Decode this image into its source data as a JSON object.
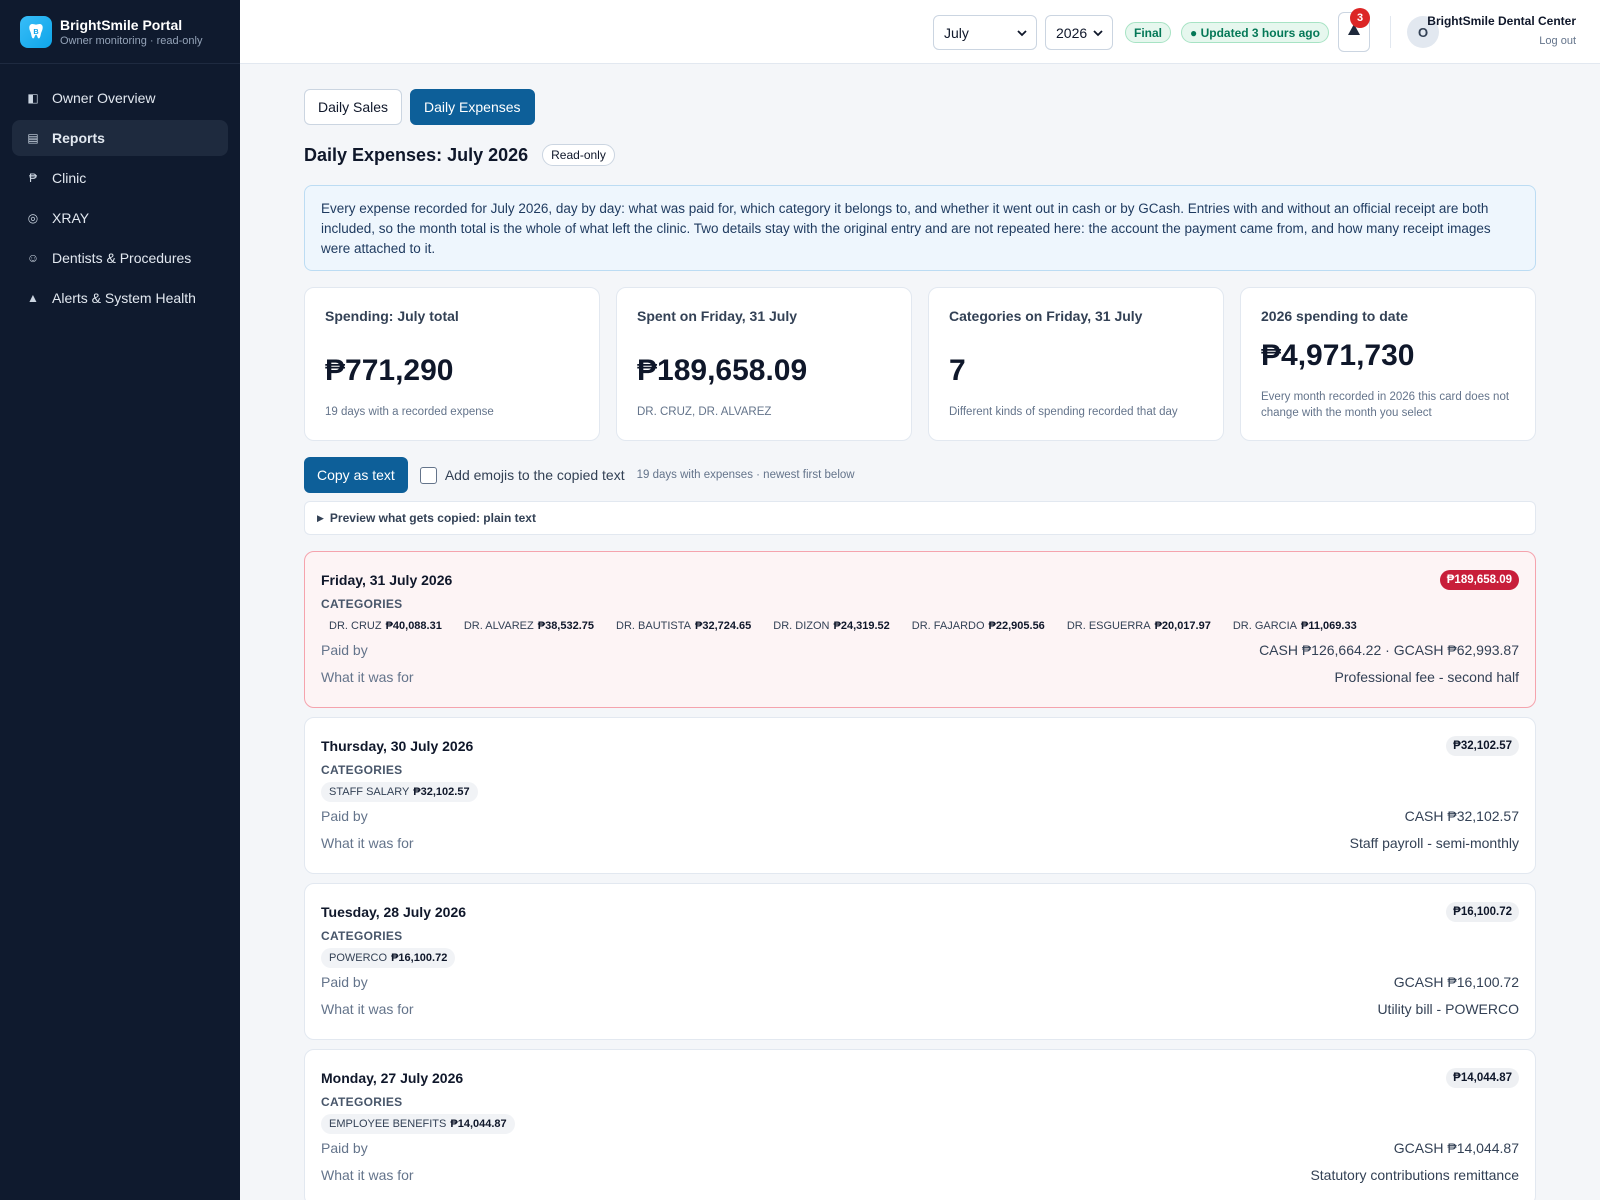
{
  "brand": {
    "name": "BrightSmile Portal",
    "subtitle": "Owner monitoring · read-only"
  },
  "sidebar": {
    "items": [
      {
        "label": "Owner Overview",
        "icon": "overview-icon",
        "glyph": "◧",
        "active": false
      },
      {
        "label": "Reports",
        "icon": "reports-icon",
        "glyph": "▤",
        "active": true
      },
      {
        "label": "Clinic",
        "icon": "peso-icon",
        "glyph": "₱",
        "active": false
      },
      {
        "label": "XRAY",
        "icon": "xray-icon",
        "glyph": "◎",
        "active": false
      },
      {
        "label": "Dentists & Procedures",
        "icon": "dentist-icon",
        "glyph": "☺",
        "active": false
      },
      {
        "label": "Alerts & System Health",
        "icon": "alert-icon",
        "glyph": "▲",
        "active": false
      }
    ]
  },
  "topbar": {
    "month": "July",
    "year": "2026",
    "status": "Final",
    "updated": "● Updated 3 hours ago",
    "alert_count": "3",
    "avatar_initial": "O",
    "user_name": "BrightSmile Dental Center",
    "logout": "Log out"
  },
  "tabs": {
    "sales": "Daily Sales",
    "expenses": "Daily Expenses"
  },
  "page": {
    "title": "Daily Expenses: July 2026",
    "badge": "Read-only"
  },
  "info": "Every expense recorded for July 2026, day by day: what was paid for, which category it belongs to, and whether it went out in cash or by GCash. Entries with and without an official receipt are both included, so the month total is the whole of what left the clinic. Two details stay with the original entry and are not repeated here: the account the payment came from, and how many receipt images were attached to it.",
  "cards": [
    {
      "label": "Spending: July total",
      "value": "₱771,290",
      "sub": "19 days with a recorded expense"
    },
    {
      "label": "Spent on Friday, 31 July",
      "value": "₱189,658.09",
      "sub": "DR. CRUZ, DR. ALVAREZ"
    },
    {
      "label": "Categories on Friday, 31 July",
      "value": "7",
      "sub": "Different kinds of spending recorded that day"
    },
    {
      "label": "2026 spending to date",
      "value": "₱4,971,730",
      "sub": "Every month recorded in 2026 this card does not change with the month you select"
    }
  ],
  "actions": {
    "copy": "Copy as text",
    "emoji_label": "Add emojis to the copied text",
    "hint": "19 days with expenses · newest first below",
    "preview": "Preview what gets copied: plain text"
  },
  "labels": {
    "categories": "CATEGORIES",
    "paid_by": "Paid by",
    "what_for": "What it was for"
  },
  "days": [
    {
      "date": "Friday, 31 July 2026",
      "total": "₱189,658.09",
      "highlight": true,
      "categories": [
        {
          "name": "DR. CRUZ",
          "amount": "₱40,088.31"
        },
        {
          "name": "DR. ALVAREZ",
          "amount": "₱38,532.75"
        },
        {
          "name": "DR. BAUTISTA",
          "amount": "₱32,724.65"
        },
        {
          "name": "DR. DIZON",
          "amount": "₱24,319.52"
        },
        {
          "name": "DR. FAJARDO",
          "amount": "₱22,905.56"
        },
        {
          "name": "DR. ESGUERRA",
          "amount": "₱20,017.97"
        },
        {
          "name": "DR. GARCIA",
          "amount": "₱11,069.33"
        }
      ],
      "paid_by": "CASH ₱126,664.22 · GCASH ₱62,993.87",
      "what_for": "Professional fee - second half"
    },
    {
      "date": "Thursday, 30 July 2026",
      "total": "₱32,102.57",
      "highlight": false,
      "categories": [
        {
          "name": "STAFF SALARY",
          "amount": "₱32,102.57"
        }
      ],
      "paid_by": "CASH ₱32,102.57",
      "what_for": "Staff payroll - semi-monthly"
    },
    {
      "date": "Tuesday, 28 July 2026",
      "total": "₱16,100.72",
      "highlight": false,
      "categories": [
        {
          "name": "POWERCO",
          "amount": "₱16,100.72"
        }
      ],
      "paid_by": "GCASH ₱16,100.72",
      "what_for": "Utility bill - POWERCO"
    },
    {
      "date": "Monday, 27 July 2026",
      "total": "₱14,044.87",
      "highlight": false,
      "categories": [
        {
          "name": "EMPLOYEE BENEFITS",
          "amount": "₱14,044.87"
        }
      ],
      "paid_by": "GCASH ₱14,044.87",
      "what_for": "Statutory contributions remittance"
    }
  ]
}
